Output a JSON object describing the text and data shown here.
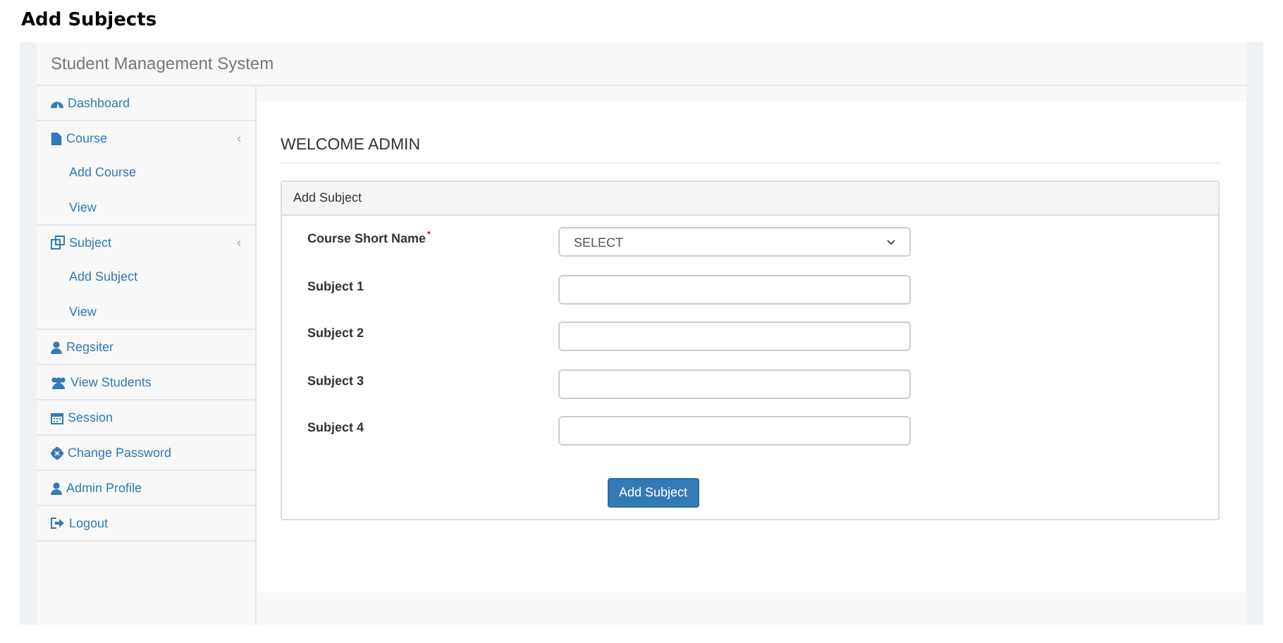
{
  "page_title": "Add Subjects",
  "navbar": {
    "brand": "Student Management System"
  },
  "sidebar": {
    "items": [
      {
        "label": "Dashboard"
      },
      {
        "label": "Course",
        "caret": "‹",
        "children": [
          {
            "label": "Add Course"
          },
          {
            "label": "View"
          }
        ]
      },
      {
        "label": "Subject",
        "caret": "‹",
        "children": [
          {
            "label": "Add Subject"
          },
          {
            "label": "View"
          }
        ]
      },
      {
        "label": "Regsiter"
      },
      {
        "label": "View Students"
      },
      {
        "label": "Session"
      },
      {
        "label": "Change Password"
      },
      {
        "label": "Admin Profile"
      },
      {
        "label": "Logout"
      }
    ]
  },
  "heading": "WELCOME ADMIN",
  "panel": {
    "title": "Add Subject",
    "fields": [
      {
        "kind": "select",
        "label": "Course Short Name",
        "required_mark": "*",
        "value": "SELECT"
      },
      {
        "kind": "text",
        "label": "Subject 1"
      },
      {
        "kind": "text",
        "label": "Subject 2"
      },
      {
        "kind": "text",
        "label": "Subject 3"
      },
      {
        "kind": "text",
        "label": "Subject 4"
      }
    ],
    "button": "Add Subject"
  }
}
